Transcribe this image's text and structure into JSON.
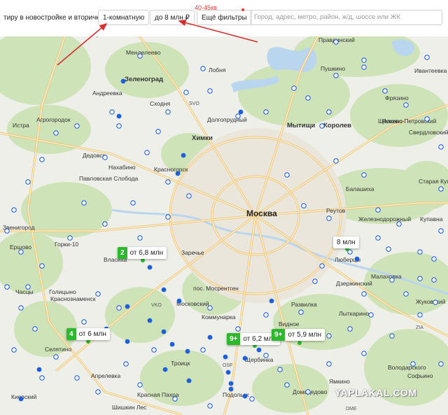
{
  "toolbar": {
    "listing_type": "тиру в новостройке и вторичке",
    "rooms": "1-комнатную",
    "price": "до 8 млн ₽",
    "more_filters": "Ещё фильтры",
    "search_placeholder": "Город, адрес, метро, район, ж/д, шоссе или ЖК"
  },
  "annotation": {
    "note": "40-45кв",
    "color": "#e53935"
  },
  "map": {
    "center_label": "Москва",
    "colors": {
      "green": "#cfe3b8",
      "water": "#b9d6ee",
      "road": "#f2c36b",
      "roadline": "#ffffff",
      "pin_blue": "#1e5fdc",
      "pin_green": "#2db82d"
    },
    "places": [
      "Поварово",
      "Менделеево",
      "Лобня",
      "Зеленоград",
      "Андреевка",
      "Сходня",
      "Долгопрудный",
      "Химки",
      "Мытищи",
      "Королев",
      "Пушкино",
      "Правдинский",
      "Ивантеевка",
      "Фрязино",
      "Щелково",
      "Лосино-Петровский",
      "Свердловский",
      "Истра",
      "Агрогородок",
      "Дедовск",
      "Нахабино",
      "Красногорск",
      "Павловская Слобода",
      "Балашиха",
      "Старая Купавна",
      "Реутов",
      "Железнодорожный",
      "Купавна",
      "Звенигород",
      "Ершово",
      "Горки-10",
      "Власиха",
      "Заречье",
      "Люберцы",
      "Малаховка",
      "Дзержинский",
      "Лыткарино",
      "Жуковский",
      "Часцы",
      "Голицыно",
      "Краснознаменск",
      "пос. Мосрентген",
      "Московский",
      "Коммунарка",
      "Развилка",
      "Видное",
      "Селятино",
      "Троицк",
      "Щербинка",
      "Подольск",
      "Домодедово",
      "Киевский",
      "Красная Пахра",
      "Шишкин Лес",
      "Ямкино",
      "Софьино",
      "Володарского",
      "Апрелевка"
    ],
    "badges": [
      "SVO",
      "VKO",
      "OSF",
      "ZIA",
      "DME"
    ]
  },
  "clusters": [
    {
      "count": "2",
      "price": "от 6,8 млн"
    },
    {
      "count": "4",
      "price": "от 6 млн"
    },
    {
      "count": "9+",
      "price": "от 6,2 млн"
    },
    {
      "count": "9+",
      "price": "от 5,9 млн"
    },
    {
      "count": "",
      "price": "8 млн"
    }
  ],
  "watermark": "YAPLAKAL.COM"
}
